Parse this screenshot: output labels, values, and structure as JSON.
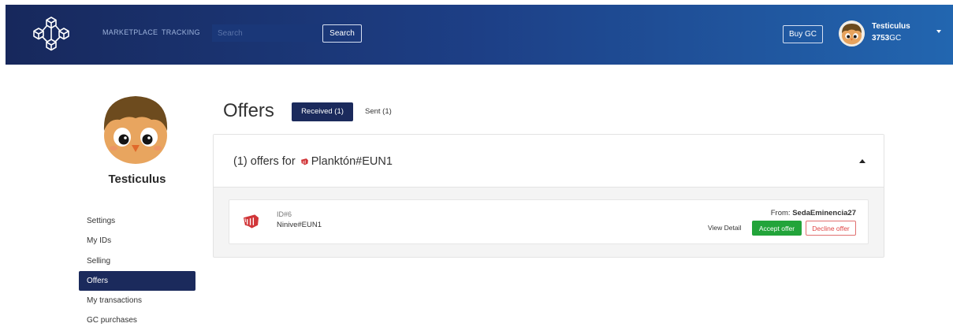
{
  "header": {
    "nav": [
      {
        "label": "MARKETPLACE"
      },
      {
        "label": "TRACKING"
      }
    ],
    "search": {
      "placeholder": "Search",
      "button_label": "Search"
    },
    "buy_gc_label": "Buy GC",
    "user": {
      "name": "Testiculus",
      "gc_amount": "3753",
      "gc_unit": "GC"
    },
    "logo_icon": "blockchain-cubes-icon",
    "menu_icon": "caret-down-icon"
  },
  "sidebar": {
    "username": "Testiculus",
    "menu": [
      {
        "label": "Settings",
        "active": false
      },
      {
        "label": "My IDs",
        "active": false
      },
      {
        "label": "Selling",
        "active": false
      },
      {
        "label": "Offers",
        "active": true
      },
      {
        "label": "My transactions",
        "active": false
      },
      {
        "label": "GC purchases",
        "active": false
      }
    ]
  },
  "main": {
    "title": "Offers",
    "tabs": [
      {
        "label": "Received (1)",
        "active": true
      },
      {
        "label": "Sent (1)",
        "active": false
      }
    ],
    "group": {
      "prefix": "(1) offers for",
      "account": "Planktón#EUN1",
      "collapse_icon": "caret-up-icon"
    },
    "offer": {
      "id_label": "ID#6",
      "account": "Ninive#EUN1",
      "from_label": "From:",
      "from_user": "SedaEminencia27",
      "view_detail": "View Detail",
      "accept": "Accept offer",
      "decline": "Decline offer",
      "icon": "riot-fist-icon"
    }
  },
  "colors": {
    "header_gradient_start": "#17285c",
    "header_gradient_end": "#2266b0",
    "active_navy": "#1b2a5c",
    "accept_green": "#22a43a",
    "decline_red": "#e04646",
    "riot_red": "#d13639"
  }
}
